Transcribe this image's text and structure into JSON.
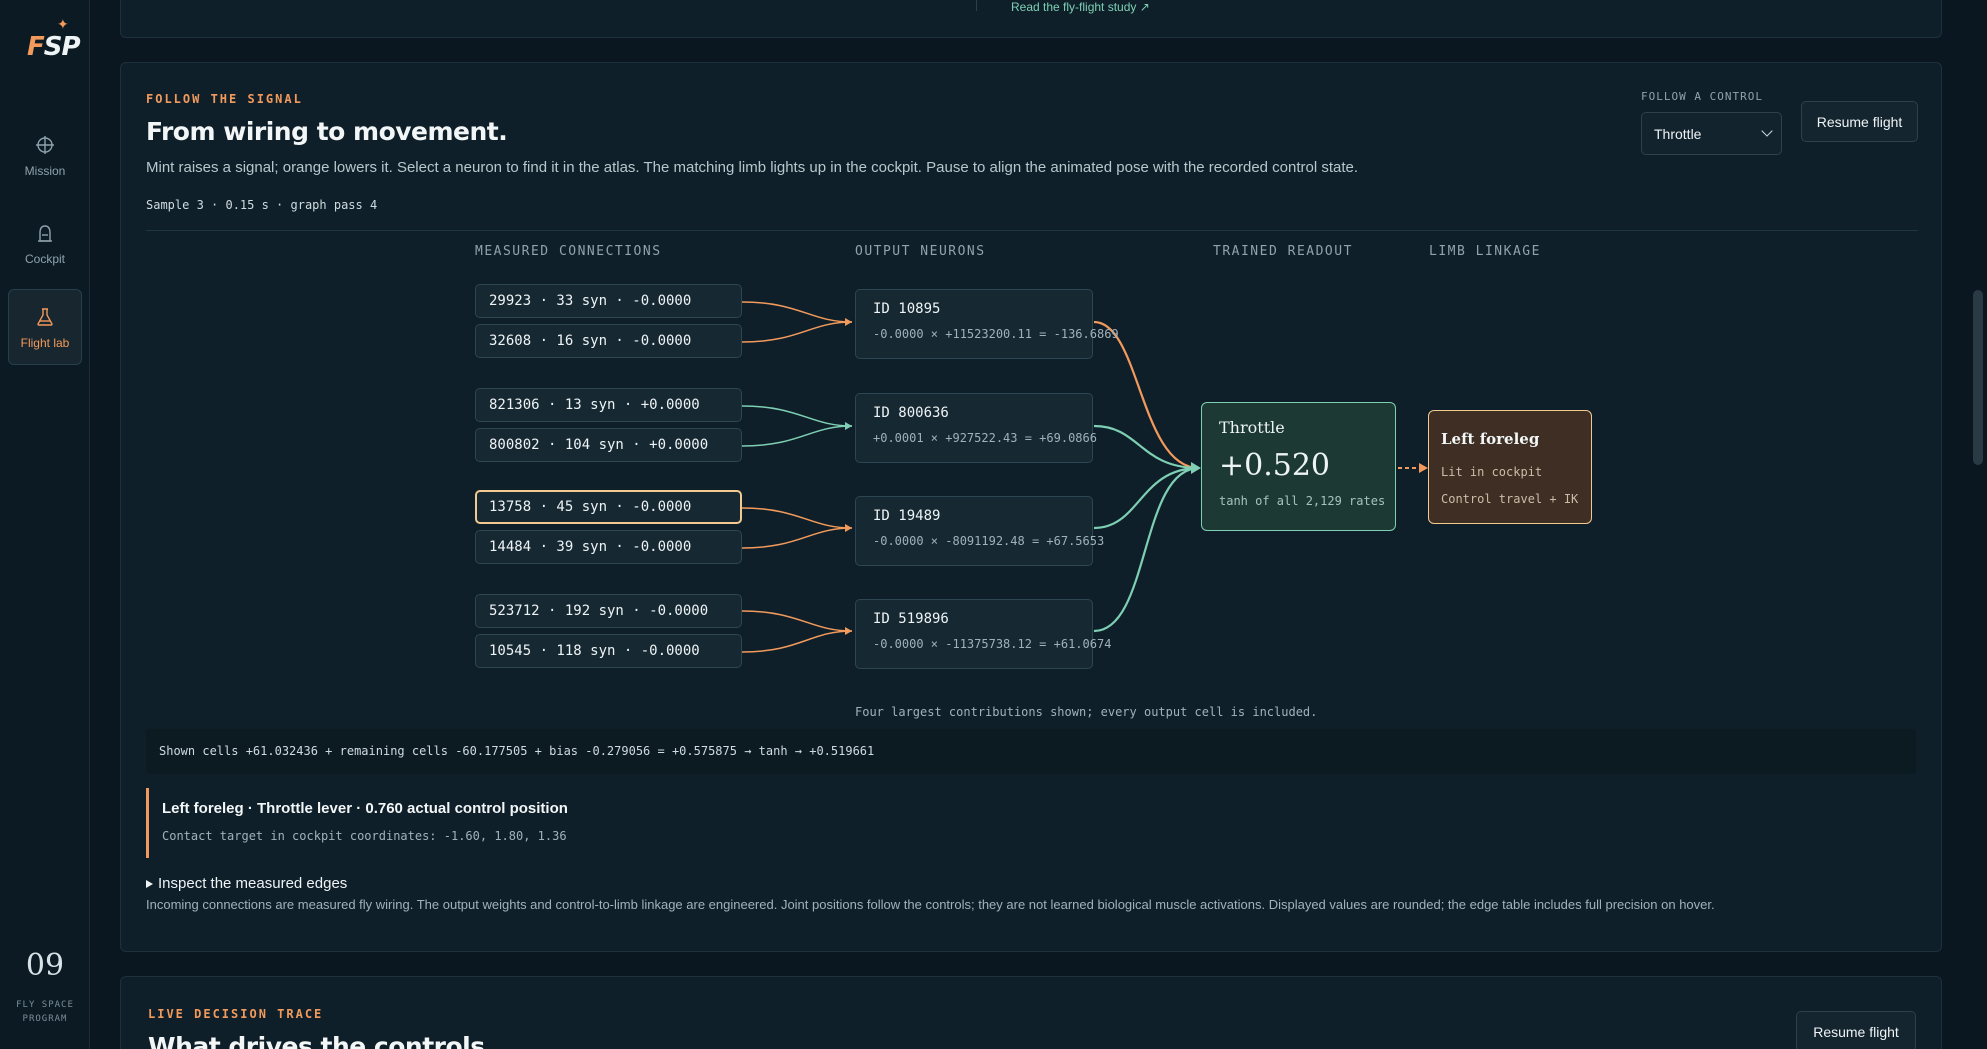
{
  "sidebar": {
    "logo_text": "FSP",
    "items": [
      {
        "label": "Mission"
      },
      {
        "label": "Cockpit"
      },
      {
        "label": "Flight lab"
      }
    ],
    "number": "09",
    "org_line1": "FLY SPACE",
    "org_line2": "PROGRAM"
  },
  "top_card": {
    "link": "Read the fly-flight study ↗"
  },
  "signal": {
    "eyebrow": "FOLLOW THE SIGNAL",
    "title": "From wiring to movement.",
    "description": "Mint raises a signal; orange lowers it. Select a neuron to find it in the atlas. The matching limb lights up in the cockpit. Pause to align the animated pose with the recorded control state.",
    "sample": "Sample 3 · 0.15 s · graph pass 4",
    "control_label": "FOLLOW A CONTROL",
    "control_value": "Throttle",
    "resume_label": "Resume flight",
    "columns": {
      "connections": "MEASURED CONNECTIONS",
      "outputs": "OUTPUT NEURONS",
      "readout": "TRAINED READOUT",
      "limb": "LIMB LINKAGE"
    },
    "connections": [
      "29923 · 33 syn · -0.0000",
      "32608 · 16 syn · -0.0000",
      "821306 · 13 syn · +0.0000",
      "800802 · 104 syn · +0.0000",
      "13758 · 45 syn · -0.0000",
      "14484 · 39 syn · -0.0000",
      "523712 · 192 syn · -0.0000",
      "10545 · 118 syn · -0.0000"
    ],
    "outputs": [
      {
        "id": "ID 10895",
        "formula": "-0.0000 × +11523200.11 = -136.6869"
      },
      {
        "id": "ID 800636",
        "formula": "+0.0001 × +927522.43 = +69.0866"
      },
      {
        "id": "ID 19489",
        "formula": "-0.0000 × -8091192.48 = +67.5653"
      },
      {
        "id": "ID 519896",
        "formula": "-0.0000 × -11375738.12 = +61.0674"
      }
    ],
    "readout": {
      "title": "Throttle",
      "value": "+0.520",
      "sub": "tanh of all 2,129 rates"
    },
    "limb": {
      "title": "Left foreleg",
      "line1": "Lit in cockpit",
      "line2": "Control travel + IK"
    },
    "footnote": "Four largest contributions shown; every output cell is included.",
    "equation": "Shown cells +61.032436 + remaining cells -60.177505 + bias -0.279056 = +0.575875 → tanh → +0.519661",
    "callout_title": "Left foreleg · Throttle lever · 0.760 actual control position",
    "callout_sub": "Contact target in cockpit coordinates: -1.60, 1.80, 1.36",
    "details_label": "Inspect the measured edges",
    "disclaimer": "Incoming connections are measured fly wiring. The output weights and control-to-limb linkage are engineered. Joint positions follow the controls; they are not learned biological muscle activations. Displayed values are rounded; the edge table includes full precision on hover."
  },
  "trace": {
    "eyebrow": "LIVE DECISION TRACE",
    "title": "What drives the controls",
    "resume_label": "Resume flight"
  },
  "colors": {
    "mint": "#7ecfb3",
    "orange": "#f29a5c",
    "highlight": "#f2c98f",
    "background": "#0b1720"
  }
}
